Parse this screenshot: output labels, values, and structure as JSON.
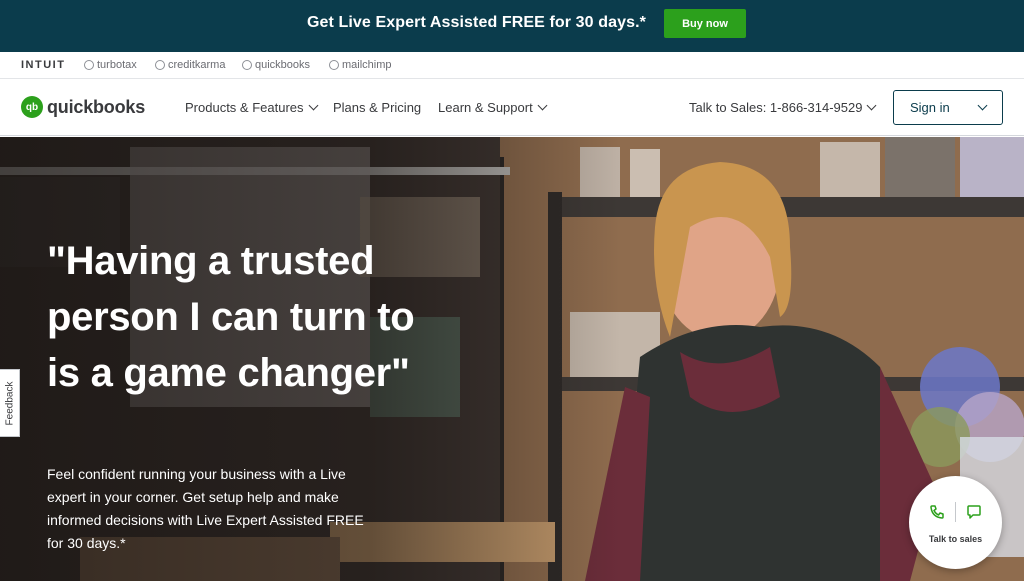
{
  "promo": {
    "text": "Get Live Expert Assisted FREE for 30 days.*",
    "button": "Buy now"
  },
  "brands": {
    "intuit": "INTUIT",
    "turbotax": "turbotax",
    "creditkarma": "creditkarma",
    "quickbooks": "quickbooks",
    "mailchimp": "mailchimp"
  },
  "nav": {
    "logo_mark": "qb",
    "logo_text": "quickbooks",
    "products": "Products & Features",
    "pricing": "Plans & Pricing",
    "learn": "Learn & Support",
    "sales": "Talk to Sales: 1-866-314-9529",
    "signin": "Sign in"
  },
  "hero": {
    "headline": "\"Having a trusted person I can turn to is a game changer\"",
    "subtext": "Feel confident running your business with a Live expert in your corner. Get setup help and make informed decisions with Live Expert Assisted FREE for 30 days.*"
  },
  "feedback": "Feedback",
  "talk_to_sales": "Talk to sales",
  "colors": {
    "banner": "#0b3c4c",
    "accent_green": "#2ca01c",
    "text_dark": "#393a3d"
  }
}
